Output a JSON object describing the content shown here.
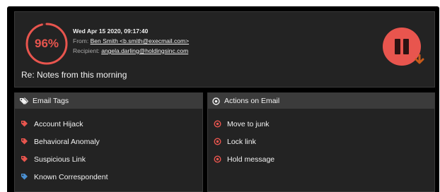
{
  "email": {
    "score": "96%",
    "score_fraction": 0.96,
    "date": "Wed Apr 15 2020, 09:17:40",
    "from_label": "From:",
    "from_value": "Ben Smith <b.smith@execmail.com>",
    "recipient_label": "Recipient:",
    "recipient_value": "angela.darling@holdingsinc.com",
    "subject": "Re: Notes from this morning"
  },
  "colors": {
    "accent_red": "#e8554e",
    "tag_blue": "#4a8fd0",
    "arrow_orange": "#c85a1a"
  },
  "header": {
    "pause_icon": "pause-icon",
    "download_icon": "arrow-down-icon"
  },
  "tags_panel": {
    "title": "Email Tags",
    "icon": "tags-icon",
    "items": [
      {
        "label": "Account Hijack",
        "icon": "tag-icon",
        "color": "#e8554e"
      },
      {
        "label": "Behavioral Anomaly",
        "icon": "tag-icon",
        "color": "#e8554e"
      },
      {
        "label": "Suspicious Link",
        "icon": "tag-icon",
        "color": "#e8554e"
      },
      {
        "label": "Known Correspondent",
        "icon": "tag-icon",
        "color": "#4a8fd0"
      }
    ]
  },
  "actions_panel": {
    "title": "Actions on Email",
    "icon": "target-icon",
    "items": [
      {
        "label": "Move to junk",
        "icon": "target-icon"
      },
      {
        "label": "Lock link",
        "icon": "target-icon"
      },
      {
        "label": "Hold message",
        "icon": "target-icon"
      }
    ]
  }
}
